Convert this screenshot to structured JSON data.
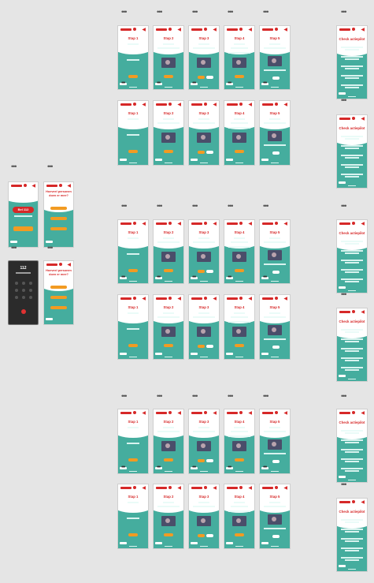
{
  "canvas": {
    "background": "#e5e5e5",
    "accent": "#45ad9e",
    "brand": "#d62828",
    "button": "#f29b22"
  },
  "menu_icon": "more-horizontal-icon",
  "left_screens": {
    "home_pill": "Bel 112",
    "persons_title": "Hoeveel personen doen er mee?",
    "dial_number": "112"
  },
  "steps": [
    "Stap 1",
    "Stap 2",
    "Stap 3",
    "Stap 4",
    "Stap 5"
  ],
  "quiz_title": "Check actiepilot"
}
